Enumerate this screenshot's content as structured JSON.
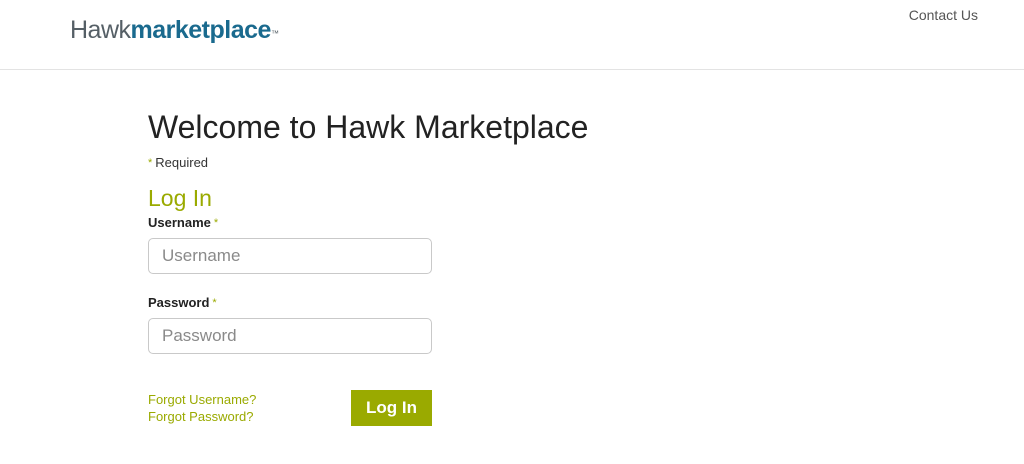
{
  "header": {
    "logo": {
      "light_text": "Hawk",
      "bold_text": "marketplace",
      "trademark": "™"
    },
    "contact_label": "Contact Us"
  },
  "main": {
    "title": "Welcome to Hawk Marketplace",
    "required_note": "Required",
    "required_marker": "*",
    "login_heading": "Log In",
    "username": {
      "label": "Username",
      "placeholder": "Username",
      "value": ""
    },
    "password": {
      "label": "Password",
      "placeholder": "Password",
      "value": ""
    },
    "forgot_username": "Forgot Username?",
    "forgot_password": "Forgot Password?",
    "submit_label": "Log In"
  },
  "colors": {
    "accent": "#9aaa00",
    "brand_blue": "#1a6a8e",
    "logo_gray": "#555f66",
    "header_border": "#e3e3e3"
  }
}
